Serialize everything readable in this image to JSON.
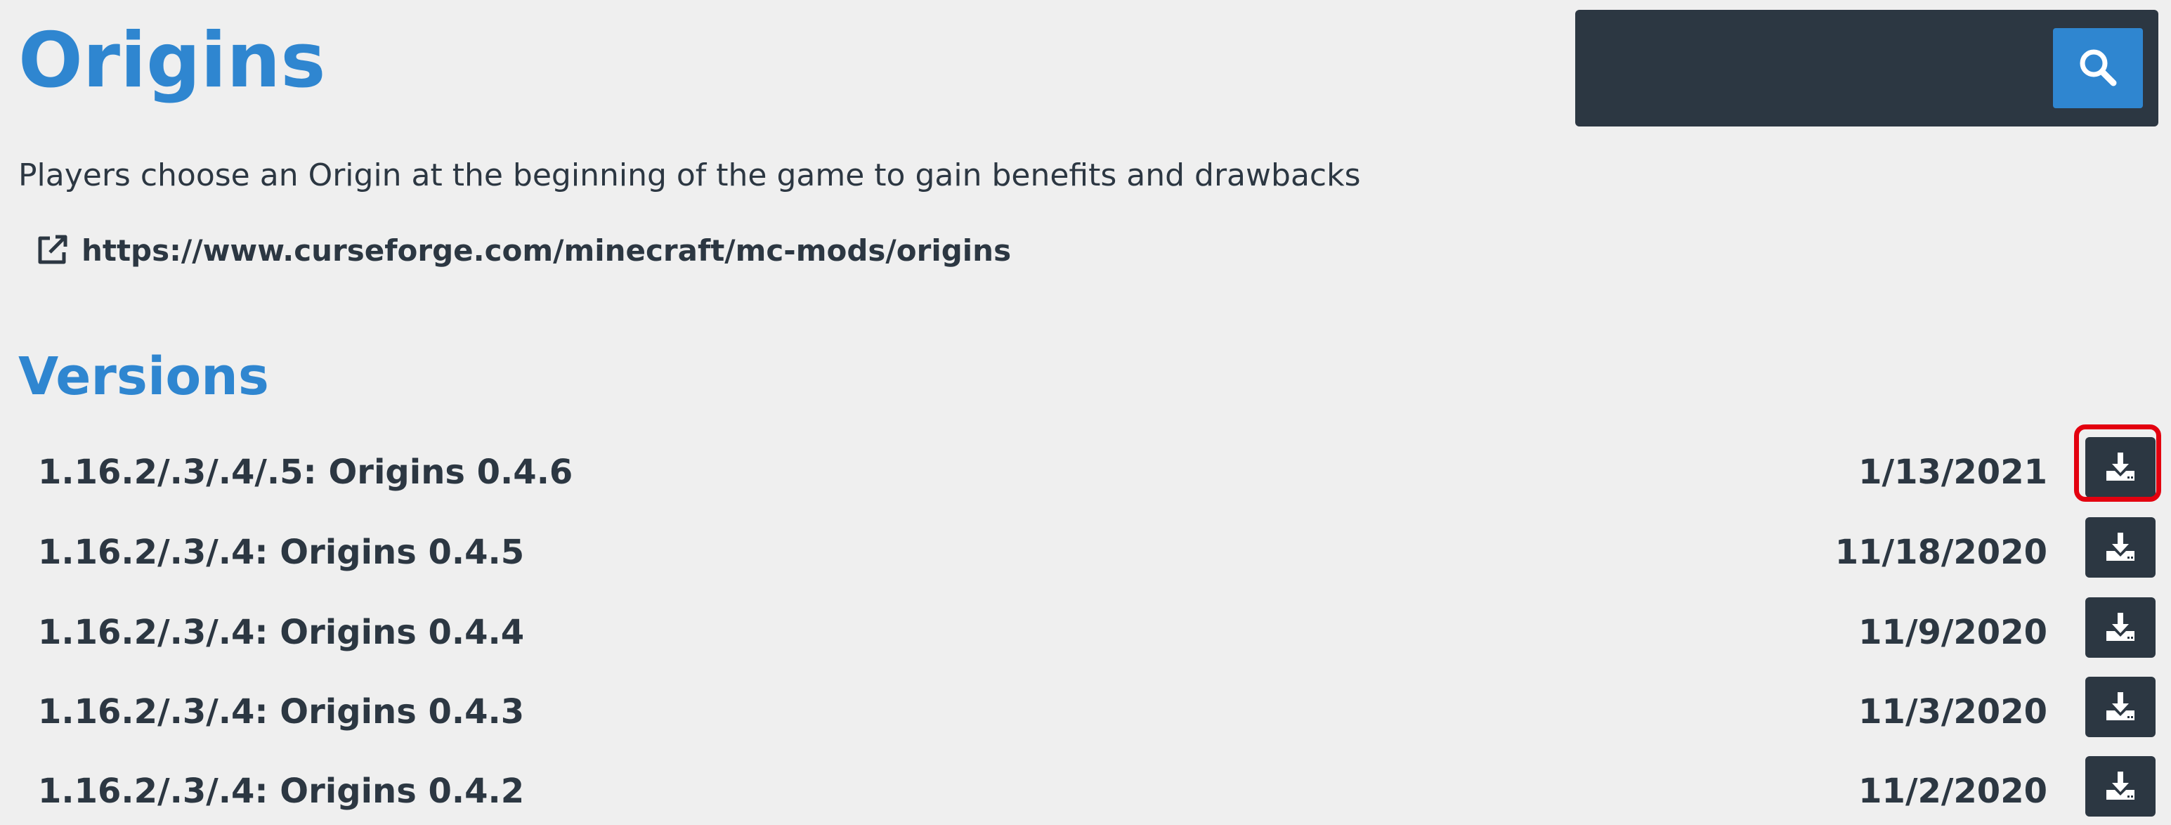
{
  "mod": {
    "title": "Origins",
    "description": "Players choose an Origin at the beginning of the game to gain benefits and drawbacks",
    "link": "https://www.curseforge.com/minecraft/mc-mods/origins"
  },
  "search": {
    "value": "",
    "placeholder": "",
    "button_icon": "search-icon"
  },
  "versions": {
    "heading": "Versions",
    "items": [
      {
        "name": "1.16.2/.3/.4/.5: Origins 0.4.6",
        "date": "1/13/2021",
        "highlighted": true
      },
      {
        "name": "1.16.2/.3/.4: Origins 0.4.5",
        "date": "11/18/2020",
        "highlighted": false
      },
      {
        "name": "1.16.2/.3/.4: Origins 0.4.4",
        "date": "11/9/2020",
        "highlighted": false
      },
      {
        "name": "1.16.2/.3/.4: Origins 0.4.3",
        "date": "11/3/2020",
        "highlighted": false
      },
      {
        "name": "1.16.2/.3/.4: Origins 0.4.2",
        "date": "11/2/2020",
        "highlighted": false
      }
    ]
  },
  "colors": {
    "accent": "#2f86d0",
    "dark": "#2c3742",
    "background": "#efefef",
    "highlight": "#e3000f"
  },
  "icons": {
    "external_link": "external-link-icon",
    "download": "download-icon"
  }
}
